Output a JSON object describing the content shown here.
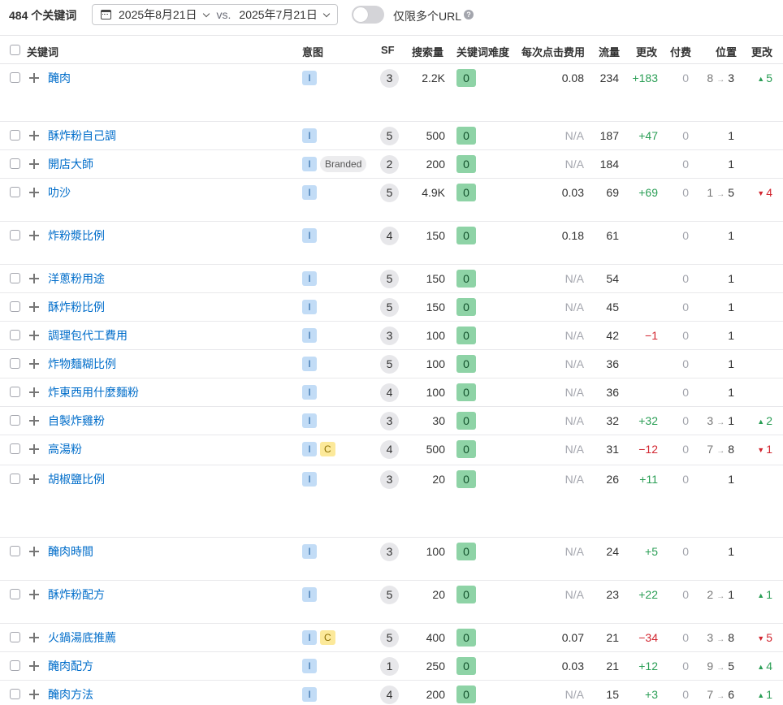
{
  "toolbar": {
    "keyword_count": "484 个关键词",
    "date_current": "2025年8月21日",
    "vs": "vs.",
    "date_compare": "2025年7月21日",
    "toggle_label": "仅限多个URL",
    "help": "?"
  },
  "columns": {
    "keyword": "关键词",
    "intent": "意图",
    "sf": "SF",
    "volume": "搜索量",
    "kd": "关键词难度",
    "cpc": "每次点击费用",
    "traffic": "流量",
    "traffic_change": "更改",
    "paid": "付费",
    "position": "位置",
    "position_change": "更改"
  },
  "rows": [
    {
      "keyword": "醃肉",
      "intents": [
        "I"
      ],
      "branded": "",
      "sf": "3",
      "volume": "2.2K",
      "kd": "0",
      "cpc": "0.08",
      "traffic": "234",
      "traffic_change": "+183",
      "paid": "0",
      "pos_from": "8",
      "pos_to": "3",
      "pos_change": "5",
      "pos_dir": "up"
    },
    {
      "keyword": "酥炸粉自己調",
      "intents": [
        "I"
      ],
      "branded": "",
      "sf": "5",
      "volume": "500",
      "kd": "0",
      "cpc": "N/A",
      "traffic": "187",
      "traffic_change": "+47",
      "paid": "0",
      "pos_from": "",
      "pos_to": "1",
      "pos_change": "",
      "pos_dir": ""
    },
    {
      "keyword": "開店大師",
      "intents": [
        "I"
      ],
      "branded": "Branded",
      "sf": "2",
      "volume": "200",
      "kd": "0",
      "cpc": "N/A",
      "traffic": "184",
      "traffic_change": "",
      "paid": "0",
      "pos_from": "",
      "pos_to": "1",
      "pos_change": "",
      "pos_dir": ""
    },
    {
      "keyword": "叻沙",
      "intents": [
        "I"
      ],
      "branded": "",
      "sf": "5",
      "volume": "4.9K",
      "kd": "0",
      "cpc": "0.03",
      "traffic": "69",
      "traffic_change": "+69",
      "paid": "0",
      "pos_from": "1",
      "pos_to": "5",
      "pos_change": "4",
      "pos_dir": "down"
    },
    {
      "keyword": "炸粉漿比例",
      "intents": [
        "I"
      ],
      "branded": "",
      "sf": "4",
      "volume": "150",
      "kd": "0",
      "cpc": "0.18",
      "traffic": "61",
      "traffic_change": "",
      "paid": "0",
      "pos_from": "",
      "pos_to": "1",
      "pos_change": "",
      "pos_dir": ""
    },
    {
      "keyword": "洋蔥粉用途",
      "intents": [
        "I"
      ],
      "branded": "",
      "sf": "5",
      "volume": "150",
      "kd": "0",
      "cpc": "N/A",
      "traffic": "54",
      "traffic_change": "",
      "paid": "0",
      "pos_from": "",
      "pos_to": "1",
      "pos_change": "",
      "pos_dir": ""
    },
    {
      "keyword": "酥炸粉比例",
      "intents": [
        "I"
      ],
      "branded": "",
      "sf": "5",
      "volume": "150",
      "kd": "0",
      "cpc": "N/A",
      "traffic": "45",
      "traffic_change": "",
      "paid": "0",
      "pos_from": "",
      "pos_to": "1",
      "pos_change": "",
      "pos_dir": ""
    },
    {
      "keyword": "調理包代工費用",
      "intents": [
        "I"
      ],
      "branded": "",
      "sf": "3",
      "volume": "100",
      "kd": "0",
      "cpc": "N/A",
      "traffic": "42",
      "traffic_change": "−1",
      "paid": "0",
      "pos_from": "",
      "pos_to": "1",
      "pos_change": "",
      "pos_dir": ""
    },
    {
      "keyword": "炸物麵糊比例",
      "intents": [
        "I"
      ],
      "branded": "",
      "sf": "5",
      "volume": "100",
      "kd": "0",
      "cpc": "N/A",
      "traffic": "36",
      "traffic_change": "",
      "paid": "0",
      "pos_from": "",
      "pos_to": "1",
      "pos_change": "",
      "pos_dir": ""
    },
    {
      "keyword": "炸東西用什麼麵粉",
      "intents": [
        "I"
      ],
      "branded": "",
      "sf": "4",
      "volume": "100",
      "kd": "0",
      "cpc": "N/A",
      "traffic": "36",
      "traffic_change": "",
      "paid": "0",
      "pos_from": "",
      "pos_to": "1",
      "pos_change": "",
      "pos_dir": ""
    },
    {
      "keyword": "自製炸雞粉",
      "intents": [
        "I"
      ],
      "branded": "",
      "sf": "3",
      "volume": "30",
      "kd": "0",
      "cpc": "N/A",
      "traffic": "32",
      "traffic_change": "+32",
      "paid": "0",
      "pos_from": "3",
      "pos_to": "1",
      "pos_change": "2",
      "pos_dir": "up"
    },
    {
      "keyword": "高湯粉",
      "intents": [
        "I",
        "C"
      ],
      "branded": "",
      "sf": "4",
      "volume": "500",
      "kd": "0",
      "cpc": "N/A",
      "traffic": "31",
      "traffic_change": "−12",
      "paid": "0",
      "pos_from": "7",
      "pos_to": "8",
      "pos_change": "1",
      "pos_dir": "down"
    },
    {
      "keyword": "胡椒鹽比例",
      "intents": [
        "I"
      ],
      "branded": "",
      "sf": "3",
      "volume": "20",
      "kd": "0",
      "cpc": "N/A",
      "traffic": "26",
      "traffic_change": "+11",
      "paid": "0",
      "pos_from": "",
      "pos_to": "1",
      "pos_change": "",
      "pos_dir": ""
    },
    {
      "keyword": "醃肉時間",
      "intents": [
        "I"
      ],
      "branded": "",
      "sf": "3",
      "volume": "100",
      "kd": "0",
      "cpc": "N/A",
      "traffic": "24",
      "traffic_change": "+5",
      "paid": "0",
      "pos_from": "",
      "pos_to": "1",
      "pos_change": "",
      "pos_dir": ""
    },
    {
      "keyword": "酥炸粉配方",
      "intents": [
        "I"
      ],
      "branded": "",
      "sf": "5",
      "volume": "20",
      "kd": "0",
      "cpc": "N/A",
      "traffic": "23",
      "traffic_change": "+22",
      "paid": "0",
      "pos_from": "2",
      "pos_to": "1",
      "pos_change": "1",
      "pos_dir": "up"
    },
    {
      "keyword": "火鍋湯底推薦",
      "intents": [
        "I",
        "C"
      ],
      "branded": "",
      "sf": "5",
      "volume": "400",
      "kd": "0",
      "cpc": "0.07",
      "traffic": "21",
      "traffic_change": "−34",
      "paid": "0",
      "pos_from": "3",
      "pos_to": "8",
      "pos_change": "5",
      "pos_dir": "down"
    },
    {
      "keyword": "醃肉配方",
      "intents": [
        "I"
      ],
      "branded": "",
      "sf": "1",
      "volume": "250",
      "kd": "0",
      "cpc": "0.03",
      "traffic": "21",
      "traffic_change": "+12",
      "paid": "0",
      "pos_from": "9",
      "pos_to": "5",
      "pos_change": "4",
      "pos_dir": "up"
    },
    {
      "keyword": "醃肉方法",
      "intents": [
        "I"
      ],
      "branded": "",
      "sf": "4",
      "volume": "200",
      "kd": "0",
      "cpc": "N/A",
      "traffic": "15",
      "traffic_change": "+3",
      "paid": "0",
      "pos_from": "7",
      "pos_to": "6",
      "pos_change": "1",
      "pos_dir": "up"
    }
  ],
  "colors": {
    "link": "#006dca",
    "positive": "#2a9e55",
    "negative": "#d22630",
    "kd_bg": "#8ed3a6",
    "intent_i_bg": "#c2dcf6",
    "intent_c_bg": "#fce99a"
  },
  "icons": {
    "calendar": "calendar-icon",
    "chevron": "chevron-down-icon",
    "add": "plus-icon",
    "help": "help-icon",
    "up": "triangle-up-icon",
    "down": "triangle-down-icon"
  }
}
